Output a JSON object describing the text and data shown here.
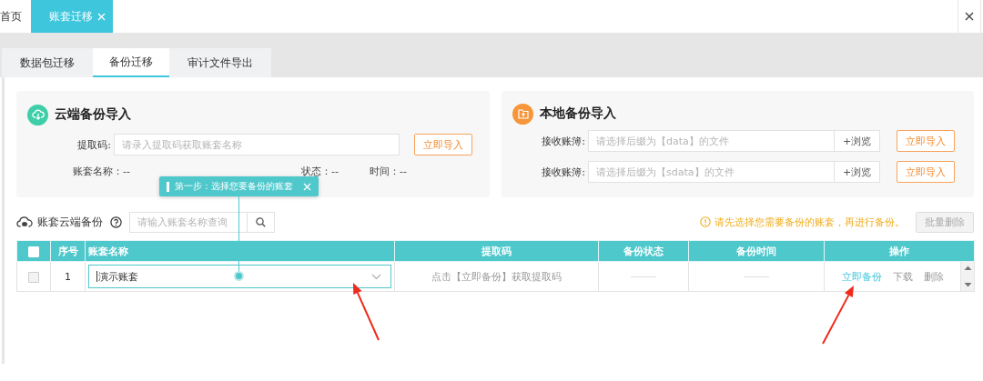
{
  "top_tabs": [
    {
      "label": "首页",
      "selected": false,
      "closable": false
    },
    {
      "label": "账套迁移",
      "selected": true,
      "closable": true
    }
  ],
  "tabs": [
    {
      "label": "数据包迁移",
      "selected": false
    },
    {
      "label": "备份迁移",
      "selected": true
    },
    {
      "label": "审计文件导出",
      "selected": false
    }
  ],
  "cloud_import": {
    "title": "云端备份导入",
    "field": {
      "label": "提取码:",
      "placeholder": "请录入提取码获取账套名称"
    },
    "button": "立即导入",
    "info": [
      {
        "label": "账套名称：",
        "value": "--"
      },
      {
        "label": "状态：",
        "value": "--"
      },
      {
        "label": "时间：",
        "value": "--"
      }
    ]
  },
  "local_import": {
    "title": "本地备份导入",
    "rows": [
      {
        "label": "接收账簿:",
        "placeholder": "请选择后缀为【data】的文件",
        "browse": "+浏览",
        "button": "立即导入"
      },
      {
        "label": "接收账簿:",
        "placeholder": "请选择后缀为【sdata】的文件",
        "browse": "+浏览",
        "button": "立即导入"
      }
    ]
  },
  "cloud_backup": {
    "title": "账套云端备份",
    "search": {
      "placeholder": "请输入账套名称查询"
    },
    "warning": "请先选择您需要备份的账套，再进行备份。",
    "batch_delete": {
      "label": "批量删除",
      "disabled": true
    }
  },
  "table": {
    "header_checked": false,
    "columns": [
      "序号",
      "账套名称",
      "提取码",
      "备份状态",
      "备份时间",
      "操作"
    ],
    "rows": [
      {
        "checked": false,
        "index": "1",
        "name": "演示账套",
        "code": "点击【立即备份】获取提取码",
        "status_empty": true,
        "time_empty": true,
        "actions": [
          {
            "label": "立即备份",
            "kind": "primary"
          },
          {
            "label": "下载",
            "kind": "plain"
          },
          {
            "label": "删除",
            "kind": "plain"
          }
        ]
      }
    ]
  },
  "tooltip": {
    "text": "第一步：选择您要备份的账套"
  }
}
